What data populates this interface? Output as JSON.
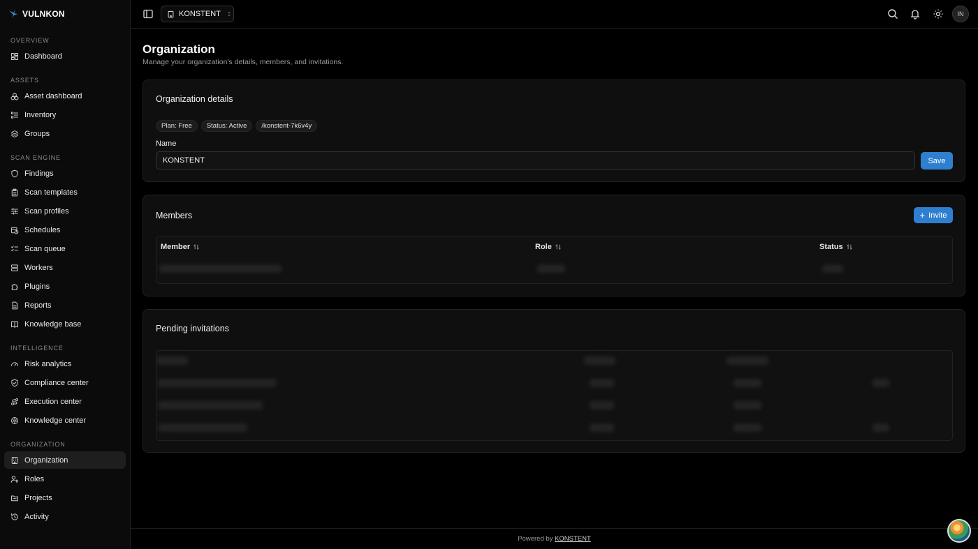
{
  "brand": {
    "name": "VULNKON"
  },
  "sidebar": {
    "sections": [
      {
        "label": "OVERVIEW",
        "items": [
          {
            "label": "Dashboard",
            "icon": "dashboard-icon"
          }
        ]
      },
      {
        "label": "ASSETS",
        "items": [
          {
            "label": "Asset dashboard",
            "icon": "boxes-icon"
          },
          {
            "label": "Inventory",
            "icon": "list-icon"
          },
          {
            "label": "Groups",
            "icon": "layers-icon"
          }
        ]
      },
      {
        "label": "SCAN ENGINE",
        "items": [
          {
            "label": "Findings",
            "icon": "shield-icon"
          },
          {
            "label": "Scan templates",
            "icon": "clipboard-icon"
          },
          {
            "label": "Scan profiles",
            "icon": "sliders-icon"
          },
          {
            "label": "Schedules",
            "icon": "calendar-clock-icon"
          },
          {
            "label": "Scan queue",
            "icon": "checklist-icon"
          },
          {
            "label": "Workers",
            "icon": "server-icon"
          },
          {
            "label": "Plugins",
            "icon": "puzzle-icon"
          },
          {
            "label": "Reports",
            "icon": "file-icon"
          },
          {
            "label": "Knowledge base",
            "icon": "book-icon"
          }
        ]
      },
      {
        "label": "INTELLIGENCE",
        "items": [
          {
            "label": "Risk analytics",
            "icon": "gauge-icon"
          },
          {
            "label": "Compliance center",
            "icon": "shield-check-icon"
          },
          {
            "label": "Execution center",
            "icon": "route-icon"
          },
          {
            "label": "Knowledge center",
            "icon": "brain-icon"
          }
        ]
      },
      {
        "label": "ORGANIZATION",
        "items": [
          {
            "label": "Organization",
            "icon": "building-icon",
            "active": true
          },
          {
            "label": "Roles",
            "icon": "user-key-icon"
          },
          {
            "label": "Projects",
            "icon": "folder-icon"
          },
          {
            "label": "Activity",
            "icon": "history-icon"
          }
        ]
      }
    ]
  },
  "header": {
    "org_switcher": "KONSTENT",
    "avatar_initials": "IN"
  },
  "page": {
    "title": "Organization",
    "subtitle": "Manage your organization's details, members, and invitations."
  },
  "details": {
    "title": "Organization details",
    "badges": [
      "Plan: Free",
      "Status: Active",
      "/konstent-7k6v4y"
    ],
    "name_label": "Name",
    "name_value": "KONSTENT",
    "save_label": "Save"
  },
  "members": {
    "title": "Members",
    "invite_label": "Invite",
    "columns": [
      "Member",
      "Role",
      "Status"
    ]
  },
  "invitations": {
    "title": "Pending invitations"
  },
  "footer": {
    "prefix": "Powered by",
    "link": "KONSTENT"
  },
  "colors": {
    "accent": "#2f7fd1",
    "background": "#000000",
    "card": "#0f0f0f"
  }
}
